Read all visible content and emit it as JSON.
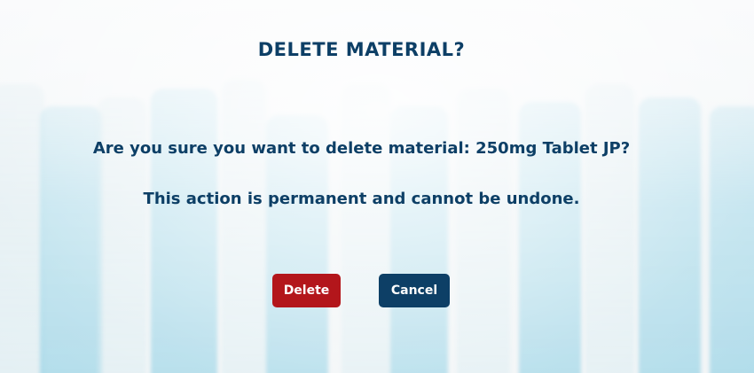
{
  "dialog": {
    "title": "DELETE MATERIAL?",
    "question": "Are you sure you want to delete material: 250mg Tablet JP?",
    "warning": "This action is permanent and cannot be undone.",
    "delete_label": "Delete",
    "cancel_label": "Cancel"
  },
  "colors": {
    "title_text": "#0d3f66",
    "delete_button": "#b3161b",
    "cancel_button": "#0d3f66",
    "button_text": "#ffffff"
  }
}
